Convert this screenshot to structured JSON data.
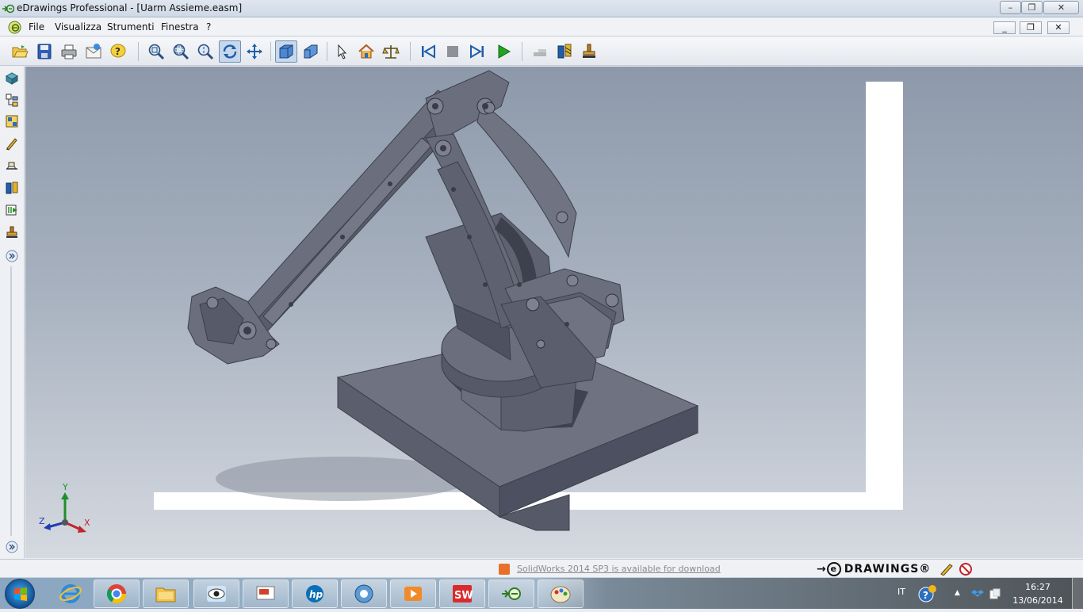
{
  "window": {
    "title": "eDrawings Professional - [Uarm Assieme.easm]",
    "min_glyph": "–",
    "max_glyph": "❐",
    "close_glyph": "✕"
  },
  "menu": {
    "items": [
      "File",
      "Visualizza",
      "Strumenti",
      "Finestra",
      "?"
    ],
    "doc_min_glyph": "_",
    "doc_restore_glyph": "❐",
    "doc_close_glyph": "✕"
  },
  "toolbar": {
    "groups": [
      [
        "open-icon",
        "save-icon",
        "print-icon",
        "send-icon",
        "help-icon"
      ],
      [
        "zoom-to-fit-icon",
        "zoom-to-area-icon",
        "zoom-in-out-icon",
        "rotate-icon",
        "pan-icon"
      ],
      [
        "shaded-icon",
        "perspective-icon"
      ],
      [
        "select-icon",
        "home-icon",
        "measure-icon"
      ],
      [
        "first-frame-icon",
        "stop-icon",
        "next-frame-icon",
        "play-icon"
      ],
      [
        "gray-tool-icon",
        "explode-icon",
        "stamp-icon"
      ]
    ],
    "pressed": [
      "rotate-icon",
      "shaded-icon"
    ]
  },
  "sidebar": {
    "items": [
      "components-icon",
      "configurations-icon",
      "model-tree-icon",
      "markup-pen-icon",
      "measure-icon",
      "explode-icon",
      "animation-icon",
      "stamp-icon",
      "expand-icon"
    ],
    "bottom": "expand-bottom-icon"
  },
  "triad": {
    "x": "X",
    "y": "Y",
    "z": "Z"
  },
  "status": {
    "update_text": "SolidWorks 2014 SP3 is available for download",
    "brand_text": "DRAWINGS®",
    "brand_e": "e"
  },
  "taskbar": {
    "apps": [
      "internet-explorer-icon",
      "chrome-icon",
      "file-explorer-icon",
      "eye-app-icon",
      "presentation-icon",
      "hp-icon",
      "network-icon",
      "media-player-icon",
      "solidworks-icon",
      "edrawings-icon",
      "paint-icon"
    ],
    "lang": "IT",
    "time": "16:27",
    "date": "13/06/2014"
  },
  "colors": {
    "viewport_top": "#8d99aa",
    "viewport_bottom": "#d5d9e0",
    "model_face": "#6a6e7d",
    "model_dark": "#4c505c",
    "accent_link": "#8a8a8a"
  }
}
